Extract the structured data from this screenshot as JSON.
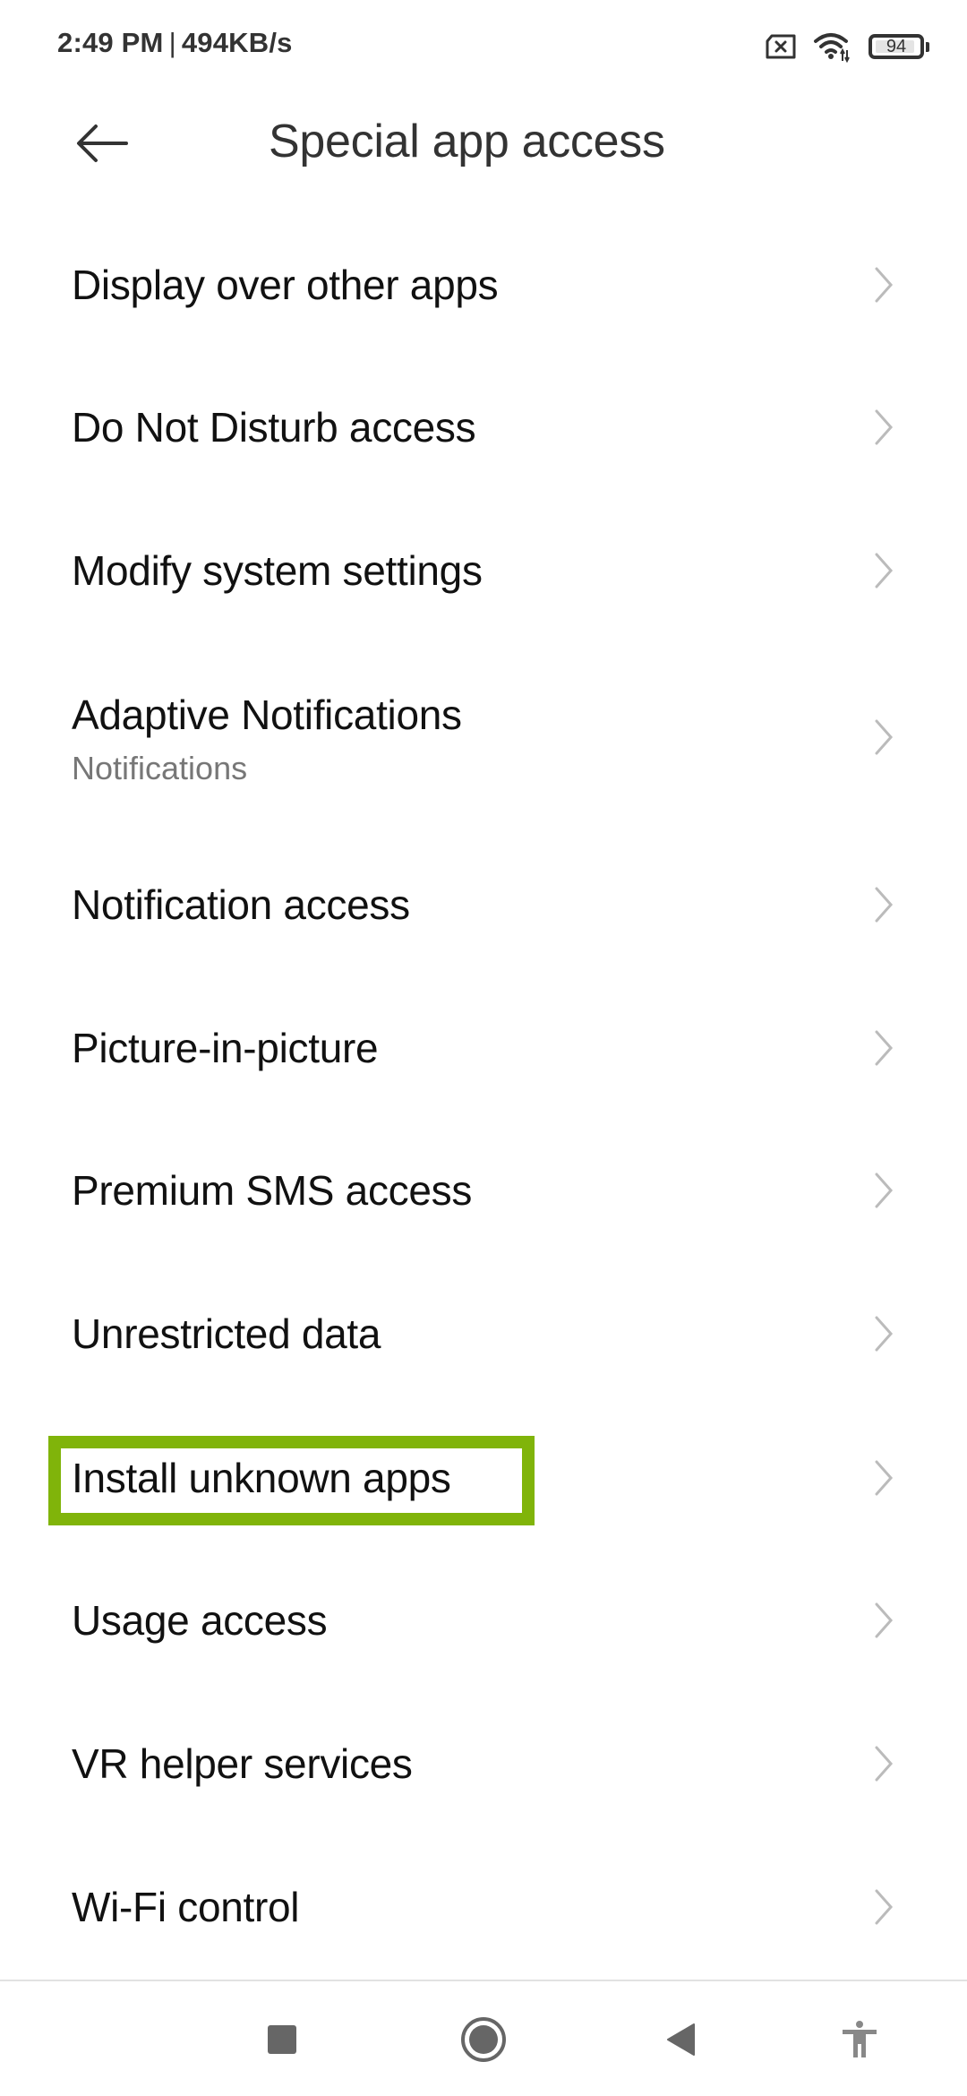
{
  "status_bar": {
    "time": "2:49 PM",
    "separator": "|",
    "network_speed": "494KB/s",
    "icons": [
      "sim-disabled-icon",
      "wifi-icon",
      "battery-icon"
    ],
    "battery_level": "94"
  },
  "header": {
    "back_icon": "arrow-left-icon",
    "title": "Special app access"
  },
  "list": {
    "items": [
      {
        "label": "Display over other apps",
        "subtitle": null
      },
      {
        "label": "Do Not Disturb access",
        "subtitle": null
      },
      {
        "label": "Modify system settings",
        "subtitle": null
      },
      {
        "label": "Adaptive Notifications",
        "subtitle": "Notifications"
      },
      {
        "label": "Notification access",
        "subtitle": null
      },
      {
        "label": "Picture-in-picture",
        "subtitle": null
      },
      {
        "label": "Premium SMS access",
        "subtitle": null
      },
      {
        "label": "Unrestricted data",
        "subtitle": null
      },
      {
        "label": "Install unknown apps",
        "subtitle": null,
        "highlighted": true
      },
      {
        "label": "Usage access",
        "subtitle": null
      },
      {
        "label": "VR helper services",
        "subtitle": null
      },
      {
        "label": "Wi-Fi control",
        "subtitle": null
      }
    ],
    "chevron_icon": "chevron-right-icon"
  },
  "highlight": {
    "target": "Install unknown apps",
    "color": "#80b40a"
  },
  "nav_bar": {
    "buttons": [
      "recents-square-icon",
      "home-circle-icon",
      "back-triangle-icon",
      "accessibility-icon"
    ]
  },
  "colors": {
    "text_primary": "#111111",
    "text_secondary": "#777777",
    "title": "#333333",
    "chevron": "#bbbbbb",
    "nav_icon": "#666666"
  }
}
